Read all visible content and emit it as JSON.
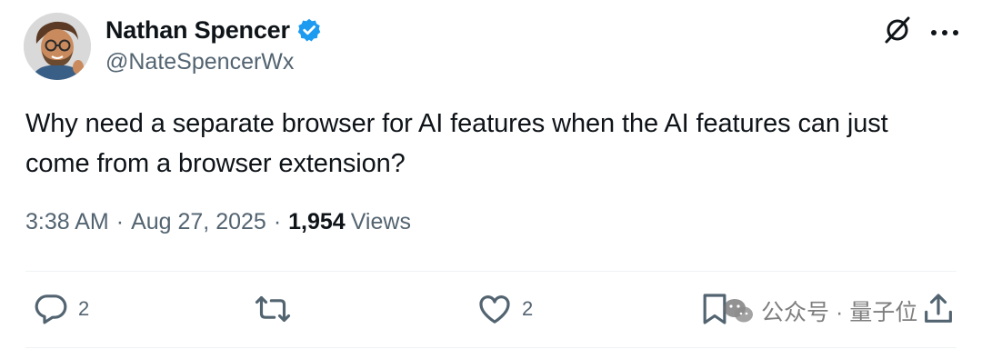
{
  "author": {
    "display_name": "Nathan Spencer",
    "handle": "@NateSpencerWx",
    "verified": true,
    "verified_color": "#1d9bf0"
  },
  "tweet": {
    "text": "Why need a separate browser for AI features when the AI features can just come from a browser extension?",
    "time": "3:38 AM",
    "separator": "·",
    "date": "Aug 27, 2025",
    "views_count": "1,954",
    "views_label": "Views"
  },
  "actions": {
    "reply_count": "2",
    "like_count": "2"
  },
  "icons": {
    "header": [
      "grok-icon",
      "more-icon"
    ],
    "actions": [
      "reply-icon",
      "repost-icon",
      "like-icon",
      "bookmark-icon",
      "share-icon"
    ]
  },
  "watermark": {
    "text": "公众号 · 量子位"
  },
  "colors": {
    "text_primary": "#0f1419",
    "text_secondary": "#536471",
    "divider": "#eff3f4"
  }
}
